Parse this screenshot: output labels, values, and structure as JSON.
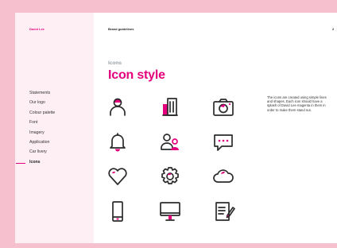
{
  "header": {
    "brand": "David Lee",
    "document_title": "Brand guidelines",
    "page_number": "2"
  },
  "sidebar": {
    "items": [
      {
        "label": "Statements",
        "active": false
      },
      {
        "label": "Our logo",
        "active": false
      },
      {
        "label": "Colour palette",
        "active": false
      },
      {
        "label": "Font",
        "active": false
      },
      {
        "label": "Imagery",
        "active": false
      },
      {
        "label": "Application",
        "active": false
      },
      {
        "label": "Car livery",
        "active": false
      },
      {
        "label": "Icons",
        "active": true
      }
    ]
  },
  "content": {
    "section_label": "Icons",
    "heading": "Icon style",
    "description": "The icons are created using simple lines and shapes. Each icon should have a splash of David Lee magenta in them in order to make them stand out."
  },
  "icons": [
    "user-icon",
    "building-icon",
    "camera-icon",
    "bell-icon",
    "users-icon",
    "chat-icon",
    "heart-icon",
    "gear-icon",
    "cloud-icon",
    "mobile-icon",
    "monitor-icon",
    "document-edit-icon"
  ],
  "colors": {
    "accent": "#e4007c",
    "page_background": "#f7c0cf",
    "sidebar_background": "#fdeff3",
    "icon_stroke": "#2b2b2b"
  }
}
